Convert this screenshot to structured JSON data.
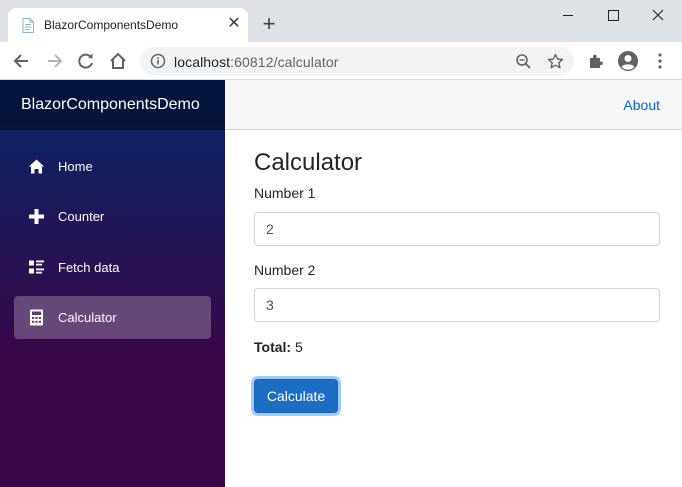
{
  "browser": {
    "tab_title": "BlazorComponentsDemo",
    "new_tab_label": "+",
    "close_tab_label": "✕",
    "url_host": "localhost",
    "url_rest": ":60812/calculator"
  },
  "app": {
    "brand": "BlazorComponentsDemo",
    "about_label": "About",
    "nav": [
      {
        "label": "Home",
        "icon": "home-icon"
      },
      {
        "label": "Counter",
        "icon": "plus-icon"
      },
      {
        "label": "Fetch data",
        "icon": "list-rich-icon"
      },
      {
        "label": "Calculator",
        "icon": "calculator-icon",
        "active": true
      }
    ]
  },
  "page": {
    "title": "Calculator",
    "number1_label": "Number 1",
    "number1_value": "2",
    "number2_label": "Number 2",
    "number2_value": "3",
    "total_label": "Total:",
    "total_value": "5",
    "calculate_label": "Calculate"
  },
  "colors": {
    "accent": "#1b6ec2",
    "link": "#0366d6",
    "sidebar_top": "#052767",
    "sidebar_bottom": "#3a0647"
  }
}
